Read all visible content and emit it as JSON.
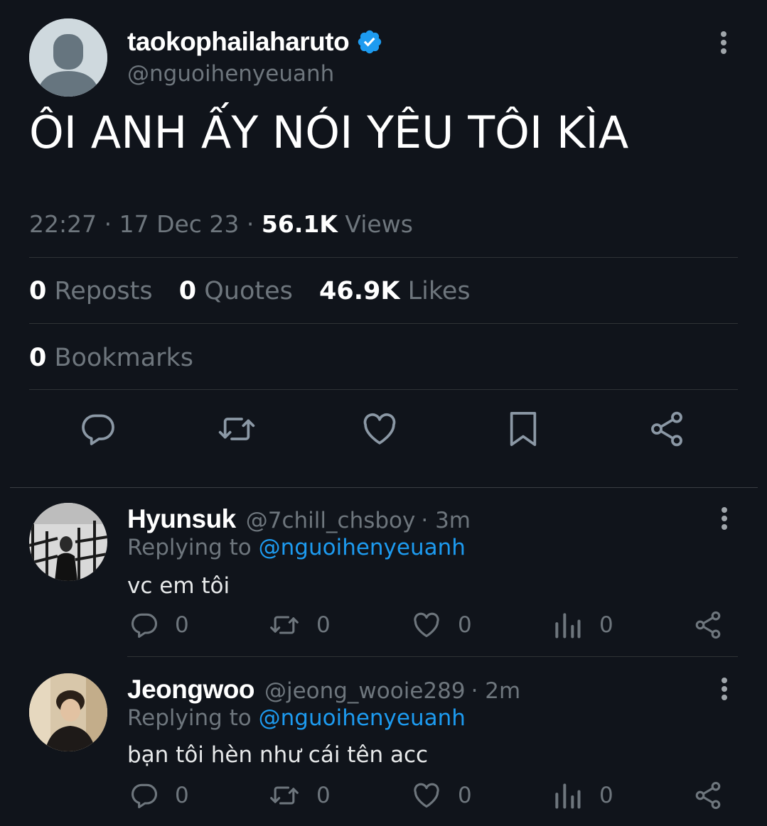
{
  "tweet": {
    "author_name": "taokophailaharuto",
    "author_handle": "@nguoihenyeuanh",
    "text": "ÔI ANH ẤY NÓI YÊU TÔI KÌA",
    "time": "22:27",
    "date": "17 Dec 23",
    "views_count": "56.1K",
    "views_label": "Views",
    "reposts_count": "0",
    "reposts_label": "Reposts",
    "quotes_count": "0",
    "quotes_label": "Quotes",
    "likes_count": "46.9K",
    "likes_label": "Likes",
    "bookmarks_count": "0",
    "bookmarks_label": "Bookmarks"
  },
  "actions": [
    "reply-icon",
    "repost-icon",
    "like-icon",
    "bookmark-icon",
    "share-icon"
  ],
  "replies": [
    {
      "name": "Hyunsuk",
      "handle": "@7chill_chsboy",
      "time": "· 3m",
      "replying_prefix": "Replying to",
      "replying_to": "@nguoihenyeuanh",
      "text": "vc em tôi",
      "reply_count": "0",
      "repost_count": "0",
      "like_count": "0",
      "views_count": "0"
    },
    {
      "name": "Jeongwoo",
      "handle": "@jeong_wooie289",
      "time": "· 2m",
      "replying_prefix": "Replying to",
      "replying_to": "@nguoihenyeuanh",
      "text": "bạn tôi hèn như cái tên acc",
      "reply_count": "0",
      "repost_count": "0",
      "like_count": "0",
      "views_count": "0"
    }
  ],
  "colors": {
    "background": "#10141b",
    "accent": "#1d9bf0",
    "muted": "#6e767d",
    "divider": "#2f3336"
  }
}
